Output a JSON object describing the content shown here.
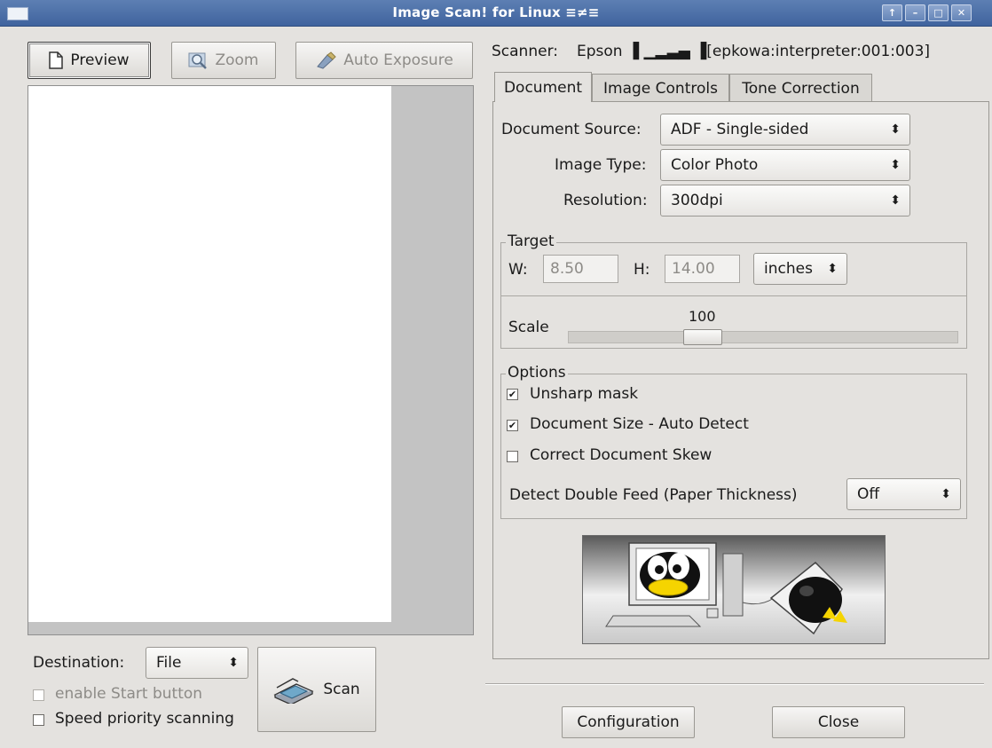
{
  "window": {
    "title": "Image Scan! for Linux ≡≠≡",
    "controls": [
      "↑",
      "–",
      "□",
      "✕"
    ]
  },
  "toolbar": {
    "preview_label": "Preview",
    "zoom_label": "Zoom",
    "auto_exposure_label": "Auto Exposure"
  },
  "scanner": {
    "label": "Scanner:",
    "value": "Epson ▐ ▁▂▃▄ ▐[epkowa:interpreter:001:003]"
  },
  "tabs": [
    {
      "label": "Document"
    },
    {
      "label": "Image Controls"
    },
    {
      "label": "Tone Correction"
    }
  ],
  "document": {
    "source_label": "Document Source:",
    "source_value": "ADF - Single-sided",
    "image_type_label": "Image Type:",
    "image_type_value": "Color Photo",
    "resolution_label": "Resolution:",
    "resolution_value": "300dpi"
  },
  "target": {
    "title": "Target",
    "w_label": "W:",
    "w_value": "8.50",
    "h_label": "H:",
    "h_value": "14.00",
    "unit_value": "inches",
    "scale_label": "Scale",
    "scale_value": "100"
  },
  "options": {
    "title": "Options",
    "unsharp_label": "Unsharp mask",
    "unsharp_checked": true,
    "autodetect_label": "Document Size - Auto Detect",
    "autodetect_checked": true,
    "skew_label": "Correct Document Skew",
    "skew_checked": false,
    "double_feed_label": "Detect Double Feed (Paper Thickness)",
    "double_feed_value": "Off"
  },
  "bottom": {
    "destination_label": "Destination:",
    "destination_value": "File",
    "start_button_label": "enable Start button",
    "speed_label": "Speed priority scanning",
    "scan_label": "Scan",
    "configuration_label": "Configuration",
    "close_label": "Close"
  },
  "colors": {
    "titlebar": "#4a6ea8",
    "window_bg": "#e4e2df",
    "preview_bg": "#c3c3c3"
  }
}
